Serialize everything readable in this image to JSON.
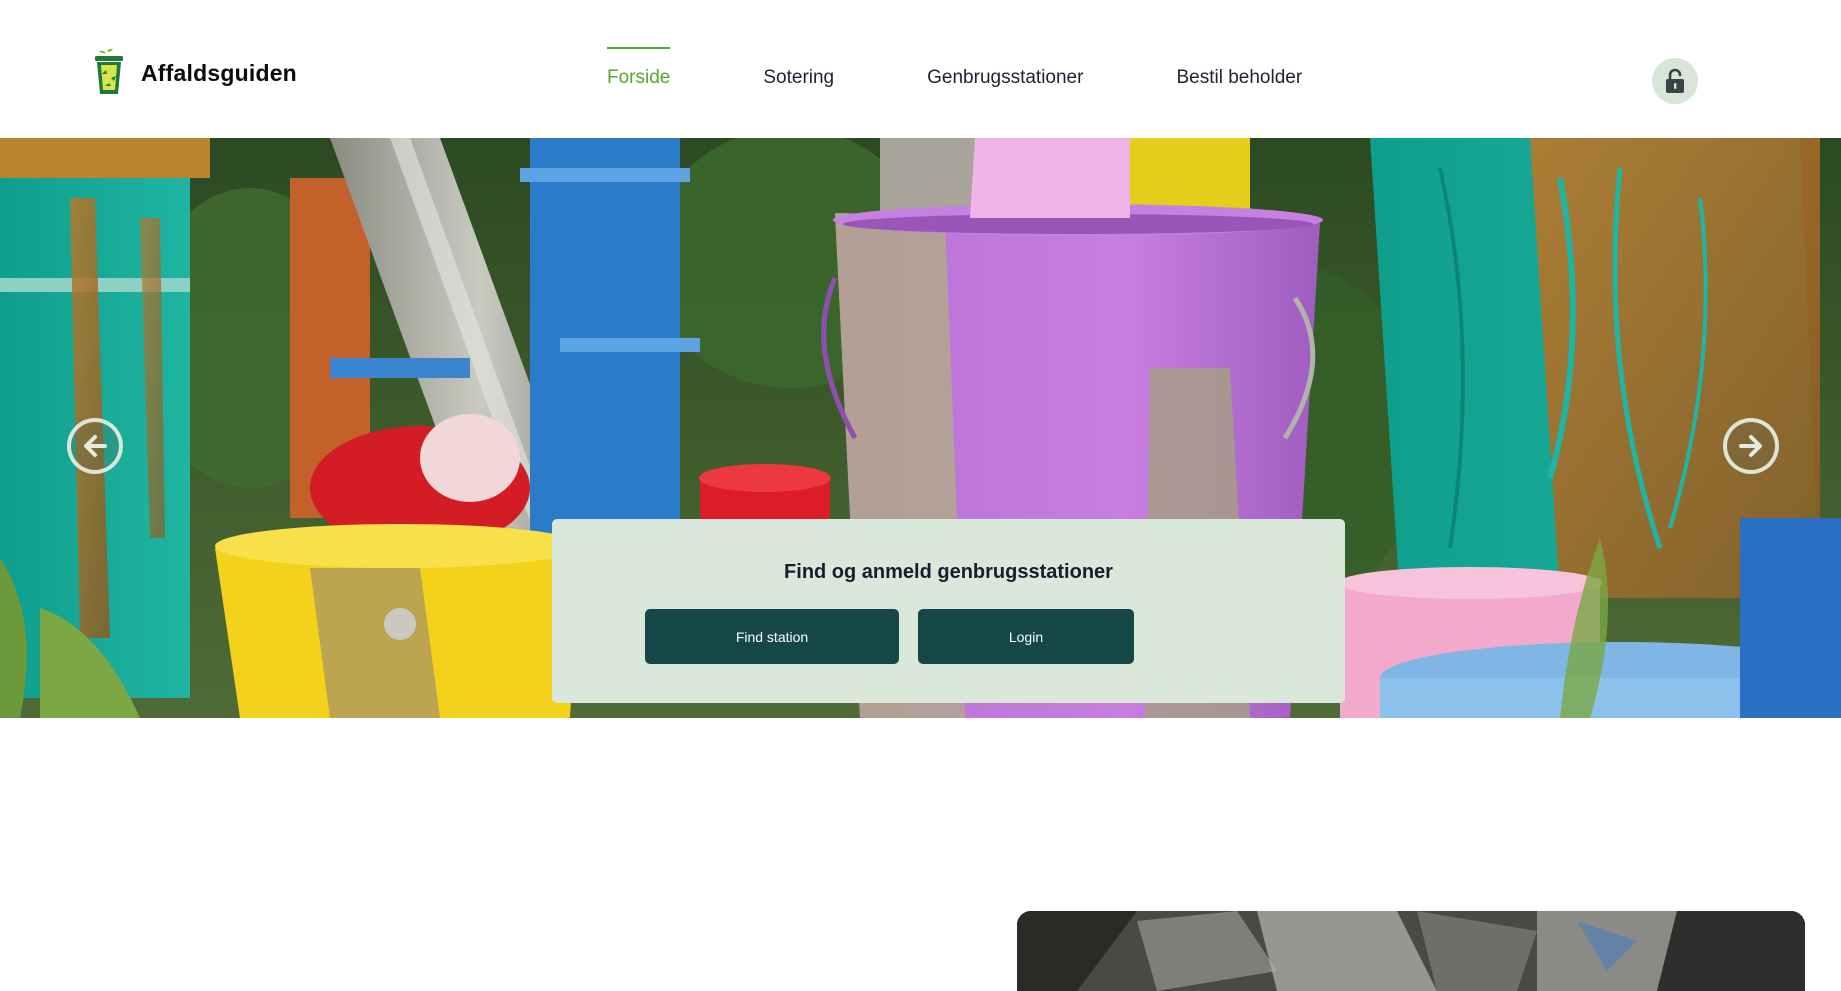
{
  "brand": {
    "name": "Affaldsguiden",
    "logo_icon": "recycle-bin-icon"
  },
  "nav": {
    "items": [
      {
        "label": "Forside",
        "active": true
      },
      {
        "label": "Sotering",
        "active": false
      },
      {
        "label": "Genbrugsstationer",
        "active": false
      },
      {
        "label": "Bestil beholder",
        "active": false
      }
    ]
  },
  "account": {
    "icon": "lock-icon"
  },
  "hero": {
    "image": "paint-buckets-photo",
    "prev_icon": "arrow-left-icon",
    "next_icon": "arrow-right-icon",
    "cta": {
      "title": "Find og anmeld genbrugsstationer",
      "find_label": "Find station",
      "login_label": "Login"
    }
  },
  "colors": {
    "accent": "#58a62c",
    "button": "#144745",
    "cta_panel": "#d9e8db",
    "lock_bg": "#d6e6d8"
  }
}
